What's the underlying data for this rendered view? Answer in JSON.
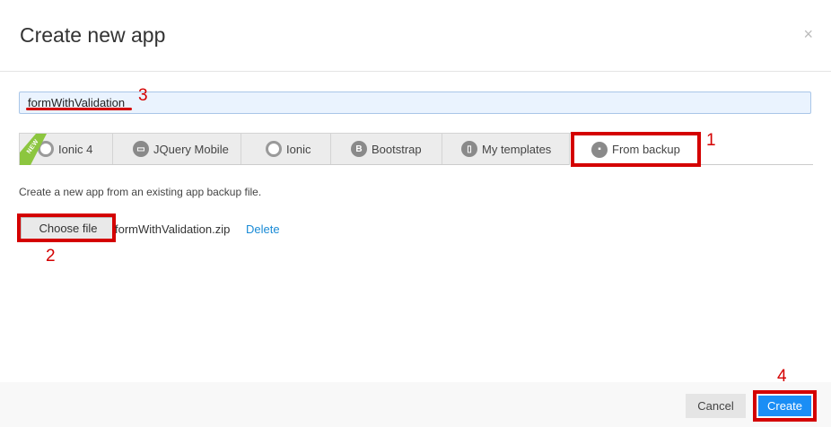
{
  "dialog": {
    "title": "Create new app",
    "close_icon": "close-icon",
    "close_glyph": "×"
  },
  "app_name": {
    "value": "formWithValidation"
  },
  "tabs": [
    {
      "label": "Ionic 4",
      "icon": "ionic-icon",
      "badge": "NEW"
    },
    {
      "label": "JQuery Mobile",
      "icon": "jquery-mobile-icon"
    },
    {
      "label": "Ionic",
      "icon": "ionic-icon"
    },
    {
      "label": "Bootstrap",
      "icon": "bootstrap-icon",
      "glyph": "B"
    },
    {
      "label": "My templates",
      "icon": "templates-icon"
    },
    {
      "label": "From backup",
      "icon": "backup-icon",
      "active": true
    }
  ],
  "content": {
    "description": "Create a new app from an existing app backup file.",
    "choose_file_label": "Choose file",
    "file_name": "formWithValidation.zip",
    "delete_label": "Delete"
  },
  "footer": {
    "cancel_label": "Cancel",
    "create_label": "Create"
  },
  "annotations": [
    "1",
    "2",
    "3",
    "4"
  ],
  "colors": {
    "annotation": "#d40000",
    "accent": "#1a8ef5",
    "new_badge": "#8cc63f"
  }
}
